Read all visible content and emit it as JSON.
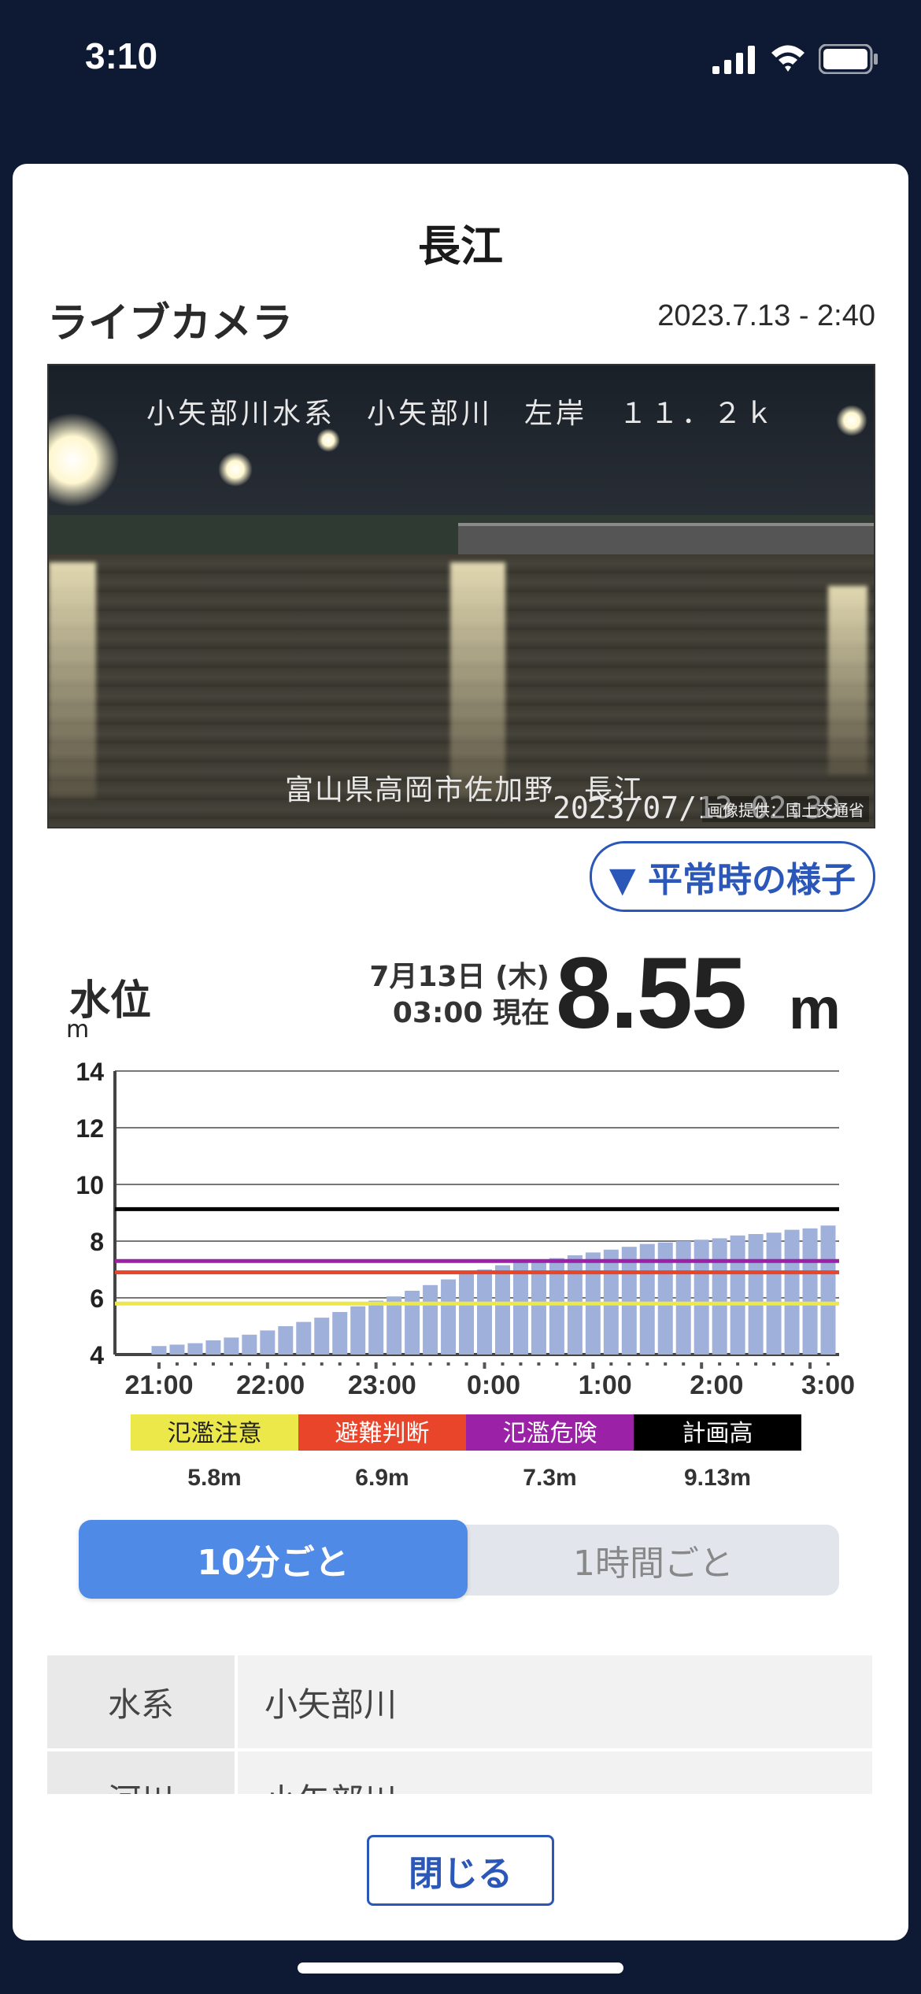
{
  "status_bar": {
    "time": "3:10"
  },
  "modal": {
    "title": "長江",
    "live_camera": {
      "heading": "ライブカメラ",
      "timestamp": "2023.7.13 - 2:40",
      "overlay_top": "小矢部川水系　小矢部川　左岸　１１．２ｋ",
      "overlay_bottom": "富山県高岡市佐加野　長江",
      "overlay_date": "2023/07/13 02:39",
      "credit": "画像提供：国土交通省"
    },
    "normal_view_button": "▼ 平常時の様子",
    "water_level": {
      "heading": "水位",
      "unit": "m",
      "date_line1": "7月13日 (木)",
      "date_line2": "03:00 現在",
      "value": "8.55",
      "value_unit": "m"
    },
    "toggle": {
      "option_10min": "10分ごと",
      "option_1hour": "1時間ごと",
      "selected": "10分ごと"
    },
    "info_table": [
      {
        "key": "水系",
        "value": "小矢部川"
      },
      {
        "key": "河川",
        "value": "小矢部川"
      }
    ],
    "close_button": "閉じる"
  },
  "chart_data": {
    "type": "bar",
    "ylabel": "m",
    "ylim": [
      4,
      14
    ],
    "yticks": [
      4,
      6,
      8,
      10,
      12,
      14
    ],
    "xticks": [
      "21:00",
      "22:00",
      "23:00",
      "0:00",
      "1:00",
      "2:00",
      "3:00"
    ],
    "grid": true,
    "bar_color": "#9fb0da",
    "values": [
      4.3,
      4.35,
      4.4,
      4.5,
      4.6,
      4.7,
      4.85,
      5.0,
      5.15,
      5.3,
      5.5,
      5.7,
      5.9,
      6.05,
      6.25,
      6.45,
      6.65,
      6.85,
      7.0,
      7.15,
      7.25,
      7.3,
      7.4,
      7.5,
      7.6,
      7.7,
      7.8,
      7.9,
      7.95,
      8.0,
      8.05,
      8.1,
      8.2,
      8.25,
      8.3,
      8.4,
      8.45,
      8.55
    ],
    "thresholds": [
      {
        "label": "氾濫注意",
        "value": 5.8,
        "display": "5.8m",
        "color": "#ece84a",
        "text_color": "#222222"
      },
      {
        "label": "避難判断",
        "value": 6.9,
        "display": "6.9m",
        "color": "#e8452a",
        "text_color": "#ffffff"
      },
      {
        "label": "氾濫危険",
        "value": 7.3,
        "display": "7.3m",
        "color": "#9b22a6",
        "text_color": "#ffffff"
      },
      {
        "label": "計画高",
        "value": 9.13,
        "display": "9.13m",
        "color": "#000000",
        "text_color": "#ffffff"
      }
    ]
  }
}
